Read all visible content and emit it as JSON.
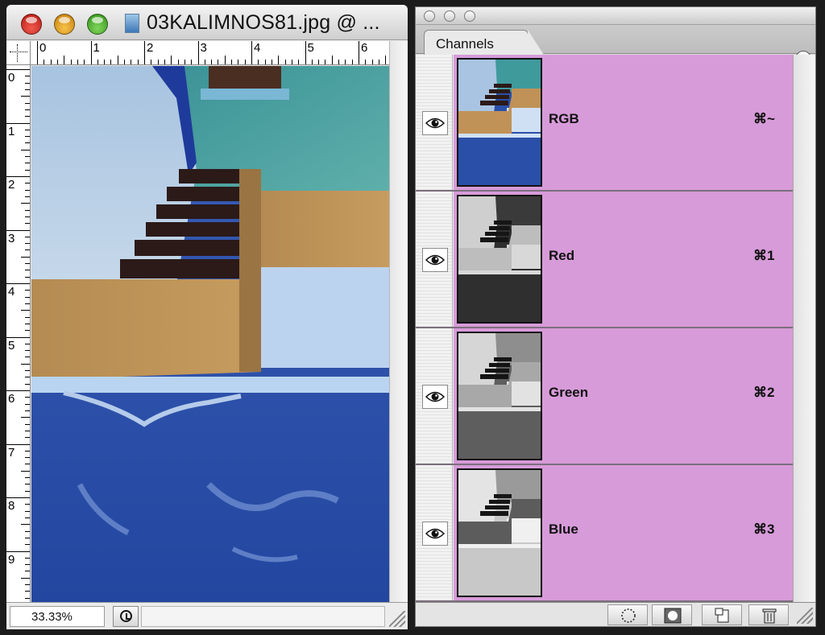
{
  "document": {
    "title": "03KALIMNOS81.jpg @ ...",
    "zoom": "33.33%",
    "ruler_h_labels": [
      "0",
      "1",
      "2",
      "3",
      "4",
      "5",
      "6"
    ],
    "ruler_v_labels": [
      "0",
      "1",
      "2",
      "3",
      "4",
      "5",
      "6",
      "7",
      "8",
      "9"
    ],
    "proxy_icon": "image-file-icon"
  },
  "panel": {
    "tab_label": "Channels",
    "menu_icon": "panel-menu-arrow-icon",
    "channels": [
      {
        "name": "RGB",
        "shortcut": "⌘~",
        "visible": true,
        "thumb": "color"
      },
      {
        "name": "Red",
        "shortcut": "⌘1",
        "visible": true,
        "thumb": "red"
      },
      {
        "name": "Green",
        "shortcut": "⌘2",
        "visible": true,
        "thumb": "green"
      },
      {
        "name": "Blue",
        "shortcut": "⌘3",
        "visible": true,
        "thumb": "blue"
      }
    ],
    "footer_buttons": [
      {
        "name": "load-channel-as-selection-button",
        "icon": "dotted-circle-icon"
      },
      {
        "name": "save-selection-as-channel-button",
        "icon": "mask-icon"
      },
      {
        "name": "create-new-channel-button",
        "icon": "new-page-icon"
      },
      {
        "name": "delete-channel-button",
        "icon": "trash-icon"
      }
    ]
  },
  "colors": {
    "selected_row": "#d79bd9",
    "wall_teal": "#3f9a9c",
    "sea_blue": "#2a4fa8",
    "ochre": "#b88f52"
  }
}
